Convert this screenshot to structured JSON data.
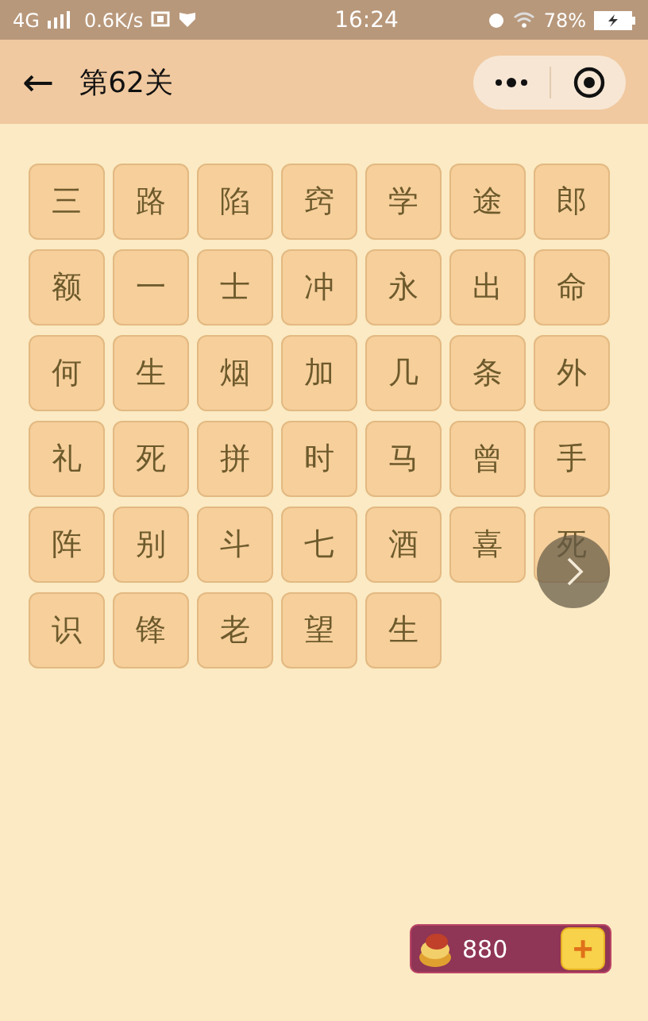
{
  "status_bar": {
    "network": "4G",
    "speed": "0.6K/s",
    "time": "16:24",
    "battery": "78%"
  },
  "header": {
    "back": "←",
    "title": "第62关"
  },
  "tiles": [
    "三",
    "路",
    "陷",
    "窍",
    "学",
    "途",
    "郎",
    "额",
    "一",
    "士",
    "冲",
    "永",
    "出",
    "命",
    "何",
    "生",
    "烟",
    "加",
    "几",
    "条",
    "外",
    "礼",
    "死",
    "拼",
    "时",
    "马",
    "曾",
    "手",
    "阵",
    "别",
    "斗",
    "七",
    "酒",
    "喜",
    "死",
    "识",
    "锋",
    "老",
    "望",
    "生"
  ],
  "coins": {
    "count": "880",
    "add": "+"
  }
}
